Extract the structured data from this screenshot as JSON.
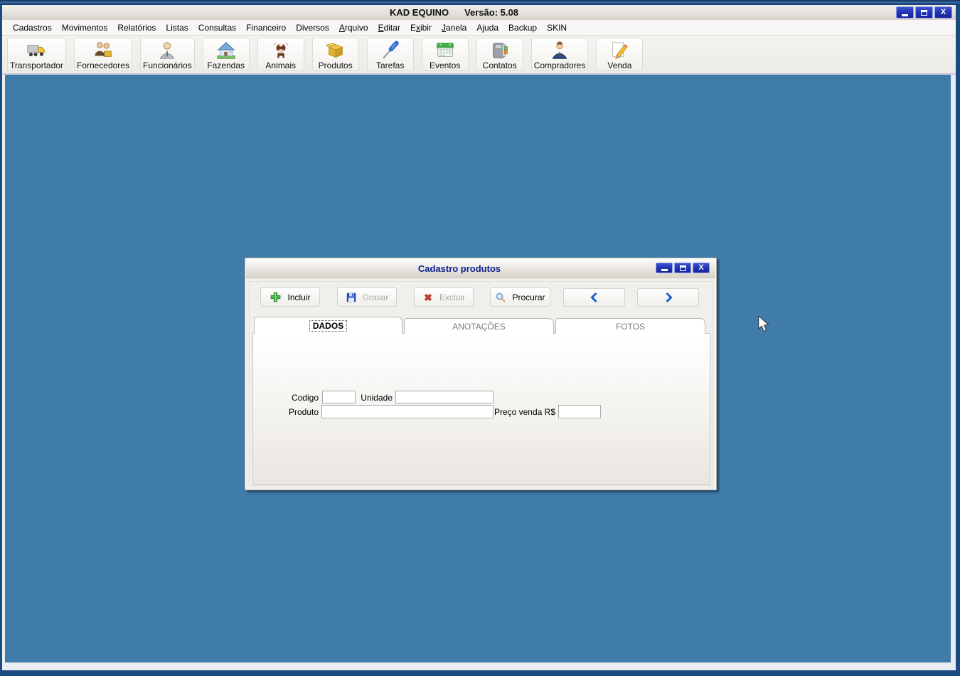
{
  "window": {
    "title": "KAD EQUINO",
    "version_label": "Versão: 5.08",
    "controls": {
      "minimize": "–",
      "maximize": "□",
      "close": "X"
    }
  },
  "menubar": {
    "items": [
      {
        "label": "Cadastros",
        "u": -1
      },
      {
        "label": "Movimentos",
        "u": -1
      },
      {
        "label": "Relatórios",
        "u": -1
      },
      {
        "label": "Listas",
        "u": -1
      },
      {
        "label": "Consultas",
        "u": -1
      },
      {
        "label": "Financeiro",
        "u": -1
      },
      {
        "label": "Diversos",
        "u": -1
      },
      {
        "label": "Arquivo",
        "u": 0
      },
      {
        "label": "Editar",
        "u": 0
      },
      {
        "label": "Exibir",
        "u": 1
      },
      {
        "label": "Janela",
        "u": 0
      },
      {
        "label": "Ajuda",
        "u": -1
      },
      {
        "label": "Backup",
        "u": -1
      },
      {
        "label": "SKIN",
        "u": -1
      }
    ]
  },
  "toolbar": {
    "items": [
      {
        "label": "Transportador",
        "icon": "truck-icon"
      },
      {
        "label": "Fornecedores",
        "icon": "suppliers-people-icon"
      },
      {
        "label": "Funcionários",
        "icon": "employee-person-icon"
      },
      {
        "label": "Fazendas",
        "icon": "farm-house-icon"
      },
      {
        "label": "Animais",
        "icon": "cow-icon"
      },
      {
        "label": "Produtos",
        "icon": "product-box-icon"
      },
      {
        "label": "Tarefas",
        "icon": "screwdriver-icon"
      },
      {
        "label": "Eventos",
        "icon": "calendar-icon"
      },
      {
        "label": "Contatos",
        "icon": "address-book-icon"
      },
      {
        "label": "Compradores",
        "icon": "buyer-person-icon"
      },
      {
        "label": "Venda",
        "icon": "pencil-icon"
      }
    ]
  },
  "desktop": {
    "background_color": "#3f7caa"
  },
  "dialog": {
    "title": "Cadastro produtos",
    "controls": {
      "minimize": "–",
      "maximize": "□",
      "close": "X"
    },
    "actions": [
      {
        "label": "Incluir",
        "icon": "plus-icon",
        "enabled": true
      },
      {
        "label": "Gravar",
        "icon": "save-floppy-icon",
        "enabled": false
      },
      {
        "label": "Excluir",
        "icon": "delete-x-icon",
        "enabled": false
      },
      {
        "label": "Procurar",
        "icon": "search-magnifier-icon",
        "enabled": true
      }
    ],
    "nav": [
      {
        "icon": "chevron-left-icon"
      },
      {
        "icon": "chevron-right-icon"
      }
    ],
    "tabs": [
      {
        "label": "DADOS",
        "active": true
      },
      {
        "label": "ANOTAÇÕES",
        "active": false
      },
      {
        "label": "FOTOS",
        "active": false
      }
    ],
    "form": {
      "fields": [
        {
          "label": "Codigo",
          "value": ""
        },
        {
          "label": "Unidade",
          "value": ""
        },
        {
          "label": "Produto",
          "value": ""
        },
        {
          "label": "Preço venda R$",
          "value": ""
        }
      ]
    }
  },
  "colors": {
    "desktop_blue": "#3f7caa",
    "window_frame_blue": "#1b4a80",
    "control_button_blue": "#2336b4",
    "dialog_title_navy": "#0a1f8f"
  }
}
